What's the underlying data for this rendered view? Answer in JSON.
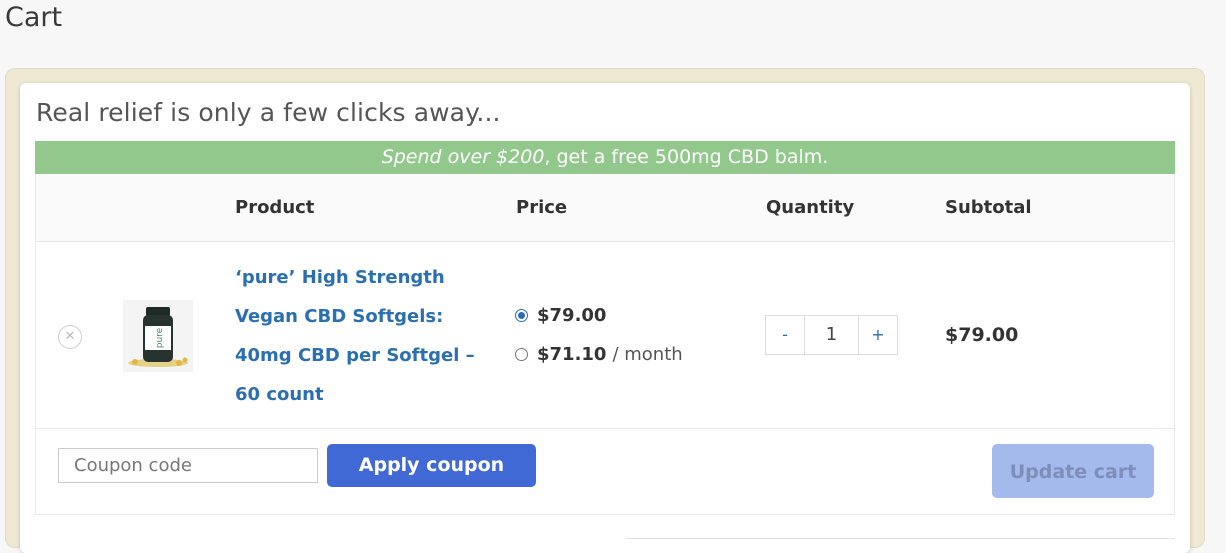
{
  "page": {
    "title": "Cart"
  },
  "cart": {
    "tagline": "Real relief is only a few clicks away...",
    "promo": {
      "highlight": "Spend over $200",
      "rest": ", get a free 500mg CBD balm."
    },
    "columns": {
      "product": "Product",
      "price": "Price",
      "quantity": "Quantity",
      "subtotal": "Subtotal"
    },
    "items": [
      {
        "remove_icon": "close-icon",
        "image_label": "pure",
        "name_lines": [
          "‘pure’ High Strength",
          "Vegan CBD Softgels:",
          "40mg CBD per Softgel –",
          "60 count"
        ],
        "price_options": [
          {
            "amount": "$79.00",
            "suffix": "",
            "selected": true
          },
          {
            "amount": "$71.10",
            "suffix": "/ month",
            "selected": false
          }
        ],
        "quantity": {
          "minus": "-",
          "value": "1",
          "plus": "+"
        },
        "subtotal": "$79.00"
      }
    ],
    "coupon": {
      "placeholder": "Coupon code",
      "apply_label": "Apply coupon"
    },
    "update_label": "Update cart"
  },
  "colors": {
    "promo_bg": "#92c88c",
    "link": "#2a6fb0",
    "apply_button": "#4169d6",
    "update_button_disabled": "#a4b9ec",
    "frame": "#efe8d3"
  }
}
